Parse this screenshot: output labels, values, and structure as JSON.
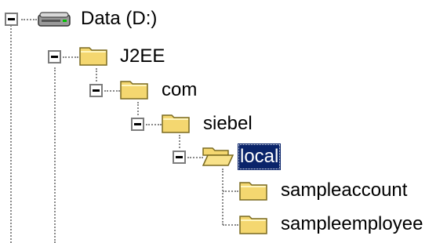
{
  "tree": {
    "drive": {
      "label": "Data (D:)",
      "icon": "drive-icon"
    },
    "nodes": [
      {
        "label": "J2EE",
        "icon": "folder-icon"
      },
      {
        "label": "com",
        "icon": "folder-icon"
      },
      {
        "label": "siebel",
        "icon": "folder-icon"
      },
      {
        "label": "local",
        "icon": "folder-open-icon",
        "selected": true
      },
      {
        "label": "sampleaccount",
        "icon": "folder-icon"
      },
      {
        "label": "sampleemployee",
        "icon": "folder-icon"
      }
    ],
    "colors": {
      "selection": "#0a246a",
      "folder": "#f4d770",
      "connector": "#8a8a8a"
    }
  }
}
